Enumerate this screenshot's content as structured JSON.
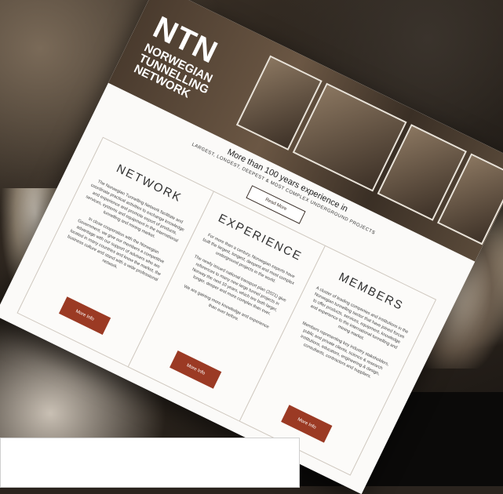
{
  "site": {
    "logo_text": "NTN",
    "logo_subtitle": "Norwegian Tunnelling Network"
  },
  "intro": {
    "headline": "More than 100 years experience in",
    "subline": "LARGEST, LONGEST, DEEPEST & MOST COMPLEX UNDERGROUND PROJECTS",
    "read_more": "Read More"
  },
  "columns": [
    {
      "title": "NETWORK",
      "paragraphs": [
        "The Norwegian Tunnelling Network facilitate and coordinate practical activities to exchange knowledge and experience and promote export of products, services, systems and equipment in the international tunnelling and mining market.",
        "In close cooperation with the Norwegian Government, we give our members a competitive advantage with our support of advisers who are located in many countries and know the market, the business culture and stand with a wide professional network."
      ],
      "button": "More Info"
    },
    {
      "title": "EXPERIENCE",
      "paragraphs": [
        "For more than a century, Norwegian experts have built the largest, longest, deepest and most complex underground projects in the world.",
        "The newly issued national transport plan (2021) give references to many new large tunnel projects in Norway the next 10 years, which are both larger, longer, deeper and more complex than ever.",
        "We are gaining more knowledge and experience than ever before."
      ],
      "button": "More Info"
    },
    {
      "title": "MEMBERS",
      "paragraphs": [
        "A cluster of leading companies and institutions in the Norwegian tunnelling sector that have joined forces to offer products, services, equipment, knowledge and experience to the international tunnelling and mining market.",
        "Members representing key industry stakeholders, public and private clients, science & research institutions, educators, engineering & design, consultants, contractors and suppliers."
      ],
      "button": "More Info"
    }
  ]
}
